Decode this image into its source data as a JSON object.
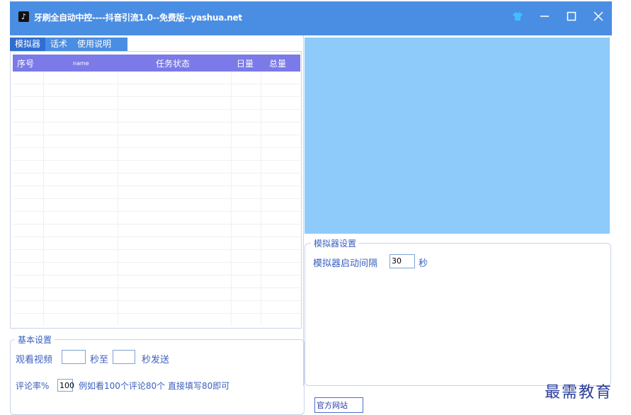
{
  "window": {
    "title": "牙刷全自动中控----抖音引流1.0--免费版--yashua.net",
    "app_icon": "tiktok-icon",
    "controls": [
      "skin-icon",
      "minimize-icon",
      "maximize-icon",
      "close-icon"
    ]
  },
  "tabs": [
    {
      "label": "模拟器",
      "active": true
    },
    {
      "label": "话术",
      "active": false
    },
    {
      "label": "使用说明",
      "active": false
    }
  ],
  "table": {
    "columns": [
      "序号",
      "name",
      "任务状态",
      "日量",
      "总量"
    ],
    "rows": []
  },
  "basic_settings": {
    "legend": "基本设置",
    "watch_label": "观看视频",
    "watch_from": "",
    "sec_to": "秒至",
    "watch_to": "",
    "sec_send": "秒发送",
    "comment_rate_label": "评论率%",
    "comment_rate_value": "100",
    "comment_hint": "例如看100个评论80个  直接填写80即可"
  },
  "emulator_settings": {
    "legend": "模拟器设置",
    "interval_label": "模拟器启动间隔",
    "interval_value": "30",
    "unit": "秒"
  },
  "official_site_button": "官方网站",
  "watermark": "最需教育",
  "colors": {
    "titlebar": "#4a8ee3",
    "table_header": "#7b7ae8",
    "preview": "#8ecbfb",
    "text": "#3b5fbf"
  }
}
